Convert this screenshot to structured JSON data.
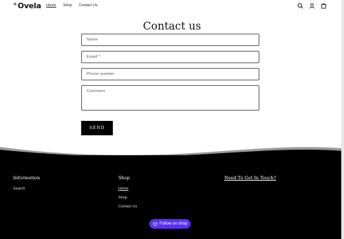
{
  "header": {
    "logo_text": "Ovela",
    "logo_mark": "+",
    "nav": [
      {
        "label": "Home"
      },
      {
        "label": "Shop"
      },
      {
        "label": "Contact Us"
      }
    ],
    "icons": [
      "search-icon",
      "account-icon",
      "cart-icon"
    ]
  },
  "form": {
    "title": "Contact us",
    "name_placeholder": "Name",
    "email_placeholder": "Email *",
    "phone_placeholder": "Phone number",
    "comment_placeholder": "Comment",
    "send_label": "SEND"
  },
  "footer": {
    "information": {
      "title": "Information",
      "links": [
        "Search"
      ]
    },
    "shop": {
      "title": "Shop",
      "links": [
        "Home",
        "Shop",
        "Contact Us"
      ]
    },
    "contact": {
      "title": "Need To Get In Touch?"
    },
    "follow_label": "Follow on shop"
  },
  "colors": {
    "follow_button": "#5a31f4",
    "footer_bg": "#000000"
  }
}
